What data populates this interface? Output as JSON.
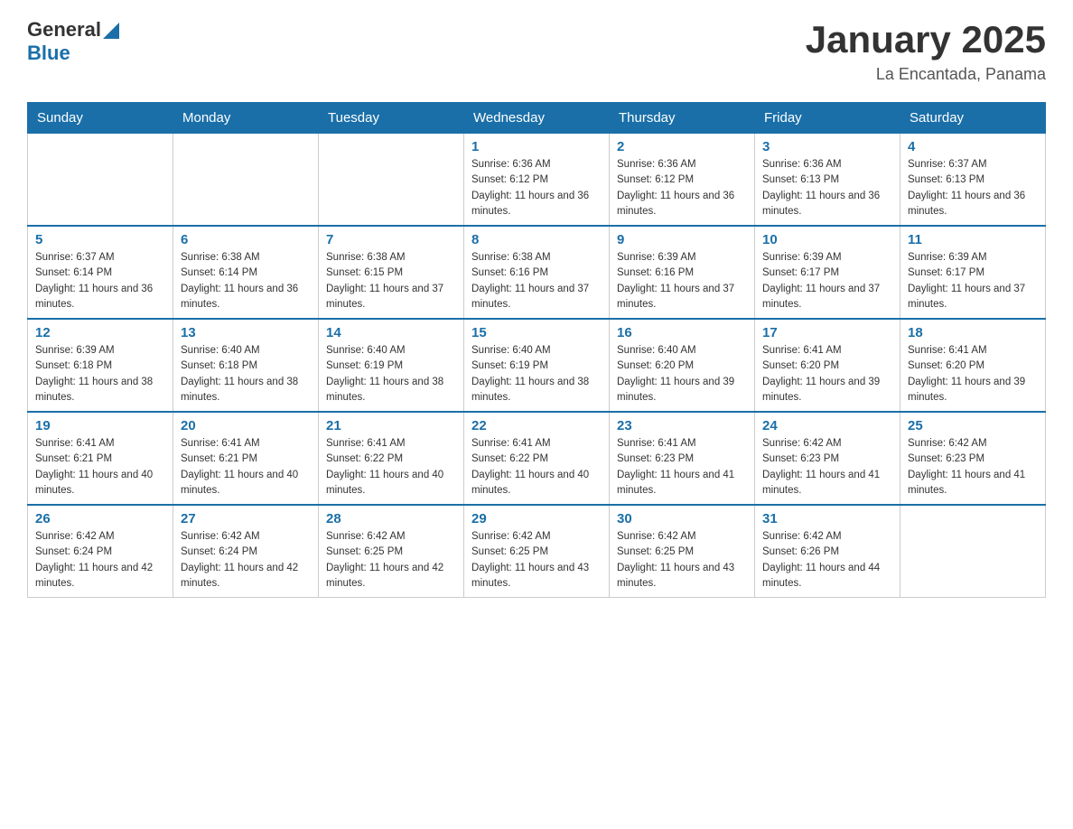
{
  "logo": {
    "general": "General",
    "blue": "Blue"
  },
  "title": "January 2025",
  "subtitle": "La Encantada, Panama",
  "days_of_week": [
    "Sunday",
    "Monday",
    "Tuesday",
    "Wednesday",
    "Thursday",
    "Friday",
    "Saturday"
  ],
  "weeks": [
    [
      {
        "day": "",
        "info": ""
      },
      {
        "day": "",
        "info": ""
      },
      {
        "day": "",
        "info": ""
      },
      {
        "day": "1",
        "info": "Sunrise: 6:36 AM\nSunset: 6:12 PM\nDaylight: 11 hours and 36 minutes."
      },
      {
        "day": "2",
        "info": "Sunrise: 6:36 AM\nSunset: 6:12 PM\nDaylight: 11 hours and 36 minutes."
      },
      {
        "day": "3",
        "info": "Sunrise: 6:36 AM\nSunset: 6:13 PM\nDaylight: 11 hours and 36 minutes."
      },
      {
        "day": "4",
        "info": "Sunrise: 6:37 AM\nSunset: 6:13 PM\nDaylight: 11 hours and 36 minutes."
      }
    ],
    [
      {
        "day": "5",
        "info": "Sunrise: 6:37 AM\nSunset: 6:14 PM\nDaylight: 11 hours and 36 minutes."
      },
      {
        "day": "6",
        "info": "Sunrise: 6:38 AM\nSunset: 6:14 PM\nDaylight: 11 hours and 36 minutes."
      },
      {
        "day": "7",
        "info": "Sunrise: 6:38 AM\nSunset: 6:15 PM\nDaylight: 11 hours and 37 minutes."
      },
      {
        "day": "8",
        "info": "Sunrise: 6:38 AM\nSunset: 6:16 PM\nDaylight: 11 hours and 37 minutes."
      },
      {
        "day": "9",
        "info": "Sunrise: 6:39 AM\nSunset: 6:16 PM\nDaylight: 11 hours and 37 minutes."
      },
      {
        "day": "10",
        "info": "Sunrise: 6:39 AM\nSunset: 6:17 PM\nDaylight: 11 hours and 37 minutes."
      },
      {
        "day": "11",
        "info": "Sunrise: 6:39 AM\nSunset: 6:17 PM\nDaylight: 11 hours and 37 minutes."
      }
    ],
    [
      {
        "day": "12",
        "info": "Sunrise: 6:39 AM\nSunset: 6:18 PM\nDaylight: 11 hours and 38 minutes."
      },
      {
        "day": "13",
        "info": "Sunrise: 6:40 AM\nSunset: 6:18 PM\nDaylight: 11 hours and 38 minutes."
      },
      {
        "day": "14",
        "info": "Sunrise: 6:40 AM\nSunset: 6:19 PM\nDaylight: 11 hours and 38 minutes."
      },
      {
        "day": "15",
        "info": "Sunrise: 6:40 AM\nSunset: 6:19 PM\nDaylight: 11 hours and 38 minutes."
      },
      {
        "day": "16",
        "info": "Sunrise: 6:40 AM\nSunset: 6:20 PM\nDaylight: 11 hours and 39 minutes."
      },
      {
        "day": "17",
        "info": "Sunrise: 6:41 AM\nSunset: 6:20 PM\nDaylight: 11 hours and 39 minutes."
      },
      {
        "day": "18",
        "info": "Sunrise: 6:41 AM\nSunset: 6:20 PM\nDaylight: 11 hours and 39 minutes."
      }
    ],
    [
      {
        "day": "19",
        "info": "Sunrise: 6:41 AM\nSunset: 6:21 PM\nDaylight: 11 hours and 40 minutes."
      },
      {
        "day": "20",
        "info": "Sunrise: 6:41 AM\nSunset: 6:21 PM\nDaylight: 11 hours and 40 minutes."
      },
      {
        "day": "21",
        "info": "Sunrise: 6:41 AM\nSunset: 6:22 PM\nDaylight: 11 hours and 40 minutes."
      },
      {
        "day": "22",
        "info": "Sunrise: 6:41 AM\nSunset: 6:22 PM\nDaylight: 11 hours and 40 minutes."
      },
      {
        "day": "23",
        "info": "Sunrise: 6:41 AM\nSunset: 6:23 PM\nDaylight: 11 hours and 41 minutes."
      },
      {
        "day": "24",
        "info": "Sunrise: 6:42 AM\nSunset: 6:23 PM\nDaylight: 11 hours and 41 minutes."
      },
      {
        "day": "25",
        "info": "Sunrise: 6:42 AM\nSunset: 6:23 PM\nDaylight: 11 hours and 41 minutes."
      }
    ],
    [
      {
        "day": "26",
        "info": "Sunrise: 6:42 AM\nSunset: 6:24 PM\nDaylight: 11 hours and 42 minutes."
      },
      {
        "day": "27",
        "info": "Sunrise: 6:42 AM\nSunset: 6:24 PM\nDaylight: 11 hours and 42 minutes."
      },
      {
        "day": "28",
        "info": "Sunrise: 6:42 AM\nSunset: 6:25 PM\nDaylight: 11 hours and 42 minutes."
      },
      {
        "day": "29",
        "info": "Sunrise: 6:42 AM\nSunset: 6:25 PM\nDaylight: 11 hours and 43 minutes."
      },
      {
        "day": "30",
        "info": "Sunrise: 6:42 AM\nSunset: 6:25 PM\nDaylight: 11 hours and 43 minutes."
      },
      {
        "day": "31",
        "info": "Sunrise: 6:42 AM\nSunset: 6:26 PM\nDaylight: 11 hours and 44 minutes."
      },
      {
        "day": "",
        "info": ""
      }
    ]
  ]
}
